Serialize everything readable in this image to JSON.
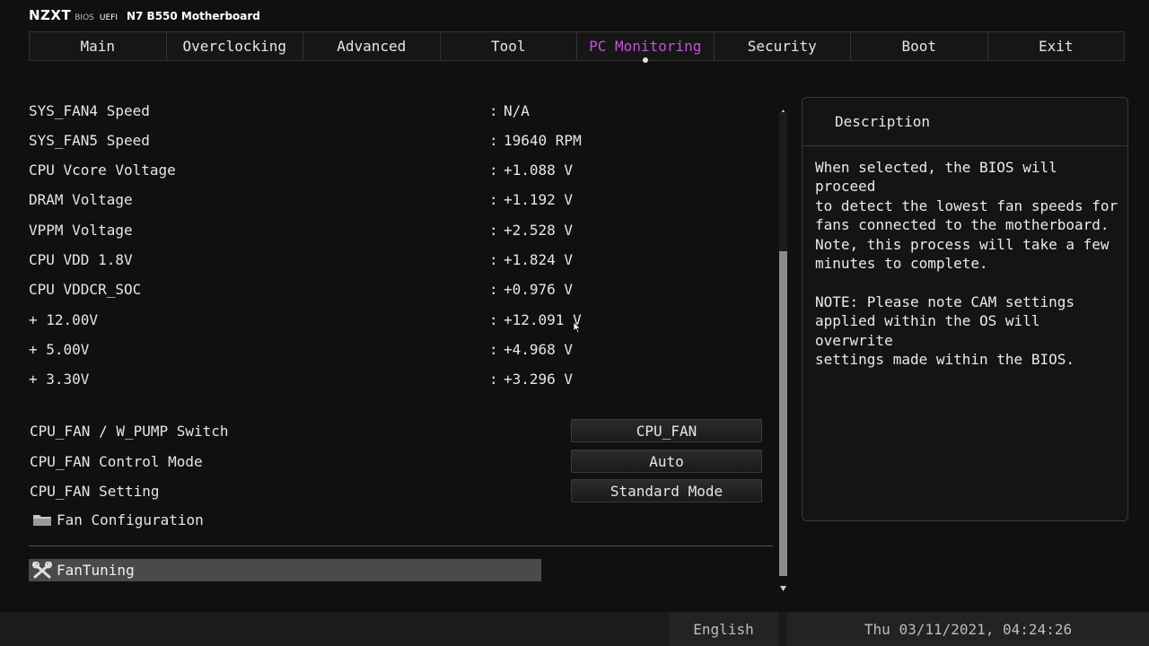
{
  "header": {
    "logo": "NZXT",
    "bios": "BIOS",
    "uefi": "UEFI",
    "model": "N7 B550 Motherboard"
  },
  "tabs": [
    {
      "label": "Main"
    },
    {
      "label": "Overclocking"
    },
    {
      "label": "Advanced"
    },
    {
      "label": "Tool"
    },
    {
      "label": "PC Monitoring",
      "active": true
    },
    {
      "label": "Security"
    },
    {
      "label": "Boot"
    },
    {
      "label": "Exit"
    }
  ],
  "readings": [
    {
      "label": "SYS_FAN4 Speed",
      "sep": ":",
      "value": "N/A"
    },
    {
      "label": "SYS_FAN5 Speed",
      "sep": ":",
      "value": "19640 RPM"
    },
    {
      "label": "CPU Vcore Voltage",
      "sep": ":",
      "value": "+1.088 V"
    },
    {
      "label": "DRAM Voltage",
      "sep": ":",
      "value": "+1.192 V"
    },
    {
      "label": "VPPM Voltage",
      "sep": ":",
      "value": "+2.528 V"
    },
    {
      "label": "CPU VDD 1.8V",
      "sep": ":",
      "value": "+1.824 V"
    },
    {
      "label": "CPU VDDCR_SOC",
      "sep": ":",
      "value": "+0.976 V"
    },
    {
      "label": "+ 12.00V",
      "sep": ":",
      "value": "+12.091 V"
    },
    {
      "label": "+ 5.00V",
      "sep": ":",
      "value": "+4.968 V"
    },
    {
      "label": "+ 3.30V",
      "sep": ":",
      "value": "+3.296 V"
    }
  ],
  "settings": [
    {
      "label": "CPU_FAN / W_PUMP Switch",
      "value": "CPU_FAN"
    },
    {
      "label": "CPU_FAN Control Mode",
      "value": "Auto"
    },
    {
      "label": "CPU_FAN Setting",
      "value": "Standard Mode"
    }
  ],
  "submenu": {
    "label": "Fan Configuration",
    "icon": "folder-icon"
  },
  "selected_item": {
    "label": "FanTuning",
    "icon": "wrench-icon"
  },
  "description": {
    "title": "Description",
    "text": "When selected, the BIOS will proceed\nto detect the lowest fan speeds for\nfans connected to the motherboard.\nNote, this process will take a few\nminutes to complete.\n\nNOTE: Please note CAM settings\napplied within the OS will overwrite\nsettings made within the BIOS."
  },
  "footer": {
    "language": "English",
    "datetime": "Thu 03/11/2021, 04:24:26"
  },
  "colors": {
    "active_tab": "#c056d6",
    "background": "#101010",
    "selected_row": "#4a4a4a"
  }
}
